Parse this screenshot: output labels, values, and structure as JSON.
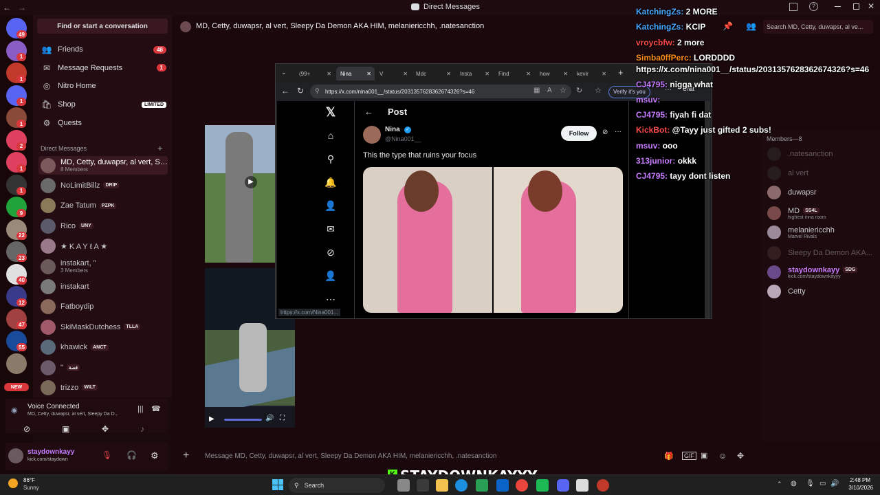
{
  "titlebar": {
    "title": "Direct Messages"
  },
  "rail": {
    "badges": [
      "49",
      "1",
      "1",
      "1",
      "1",
      "2",
      "1",
      "1",
      "9",
      "22",
      "23",
      "40",
      "12",
      "47",
      "55"
    ],
    "new_label": "NEW"
  },
  "sidebar": {
    "search": "Find or start a conversation",
    "nav": [
      {
        "label": "Friends",
        "count": "48",
        "icon": "friends-icon"
      },
      {
        "label": "Message Requests",
        "count": "1",
        "icon": "message-requests-icon"
      },
      {
        "label": "Nitro Home",
        "icon": "nitro-icon"
      },
      {
        "label": "Shop",
        "pill": "LIMITED",
        "icon": "shop-icon"
      },
      {
        "label": "Quests",
        "icon": "quests-icon"
      }
    ],
    "dm_header": "Direct Messages",
    "dms": [
      {
        "name": "MD, Cetty, duwapsr, al vert, Sle...",
        "sub": "8 Members"
      },
      {
        "name": "NoLimitBillz",
        "tag": "DRIP"
      },
      {
        "name": "Zae Tatum",
        "tag": "PZPK"
      },
      {
        "name": "Rico",
        "tag": "UNY"
      },
      {
        "name": "★ K A Y ℓ A ★"
      },
      {
        "name": "instakart, \"",
        "sub": "3 Members"
      },
      {
        "name": "instakart"
      },
      {
        "name": "Fatboydip"
      },
      {
        "name": "SkiMaskDutchess",
        "tag": "TLLA"
      },
      {
        "name": "khawick",
        "tag": "ANCT"
      },
      {
        "name": "\"",
        "tag": "قصة"
      },
      {
        "name": "trizzo",
        "tag": "WILT"
      }
    ]
  },
  "voice": {
    "status": "Voice Connected",
    "channel": "MD, Cetty, duwapsr, al vert, Sleepy Da D..."
  },
  "user": {
    "name": "staydownkayy",
    "sub": "kick.com/staydown"
  },
  "chat": {
    "header": "MD, Cetty, duwapsr, al vert, Sleepy Da Demon AKA HIM, melaniericchh, .natesanction",
    "placeholder": "Message MD, Cetty, duwapsr, al vert, Sleepy Da Demon AKA HIM, melaniericchh, .natesanction"
  },
  "browser": {
    "tabs": [
      "(99+",
      "Nina",
      "V",
      "Mdc",
      "Insta",
      "Find",
      "how",
      "kevir"
    ],
    "url": "https://x.com/nina001__/status/2031357628362674326?s=46",
    "verify": "Verify it's you",
    "chat_btn": "Chat",
    "status_url": "https://x.com/Nina001...",
    "post": {
      "header": "Post",
      "name": "Nina",
      "handle": "@Nina001__",
      "follow": "Follow",
      "text": "This the type that ruins your focus"
    }
  },
  "stream_chat": [
    {
      "user": "KatchingZs:",
      "msg": "2 MORE",
      "color": "#4aa8ff"
    },
    {
      "user": "KatchingZs:",
      "msg": "KCIP",
      "color": "#4aa8ff"
    },
    {
      "user": "vroycbfw:",
      "msg": "2 more",
      "color": "#ff4a4a"
    },
    {
      "user": "Simba0ffPerc:",
      "msg": "LORDDDD",
      "color": "#ff8c1a"
    },
    {
      "user": "",
      "msg": "https://x.com/nina001__/status/2031357628362674326?s=46",
      "color": "#fff"
    },
    {
      "user": "CJ4795:",
      "msg": "nigga what",
      "color": "#c77dff"
    },
    {
      "user": "msuv:",
      "msg": "",
      "color": "#c77dff"
    },
    {
      "user": "CJ4795:",
      "msg": "fiyah fi dat",
      "color": "#c77dff"
    },
    {
      "user": "KickBot:",
      "msg": "@Tayy just gifted 2 subs!",
      "color": "#ff4a4a"
    },
    {
      "user": "msuv:",
      "msg": "ooo",
      "color": "#c77dff"
    },
    {
      "user": "313junior:",
      "msg": "okkk",
      "color": "#c77dff"
    },
    {
      "user": "CJ4795:",
      "msg": "tayy dont listen",
      "color": "#c77dff"
    }
  ],
  "members": {
    "search": "Search MD, Cetty, duwapsr, al ve...",
    "header": "Members—8",
    "list": [
      {
        "name": ".natesanction",
        "dim": true
      },
      {
        "name": "al vert",
        "dim": true
      },
      {
        "name": "duwapsr"
      },
      {
        "name": "MD",
        "tag": "SS4L",
        "sub": "highest inna room"
      },
      {
        "name": "melaniericchh",
        "sub": "Marvel Rivals"
      },
      {
        "name": "Sleepy Da Demon AKA...",
        "dim": true
      },
      {
        "name": "staydownkayy",
        "tag": "SDG",
        "sub": "kick.com/staydownkayyy",
        "accent": "#c77dff"
      },
      {
        "name": "Cetty"
      }
    ]
  },
  "overlay": {
    "kick_name": "STAYDOWNKAYYY"
  },
  "taskbar": {
    "weather_temp": "86°F",
    "weather_desc": "Sunny",
    "search": "Search",
    "time": "2:48 PM",
    "date": "3/10/2026"
  }
}
